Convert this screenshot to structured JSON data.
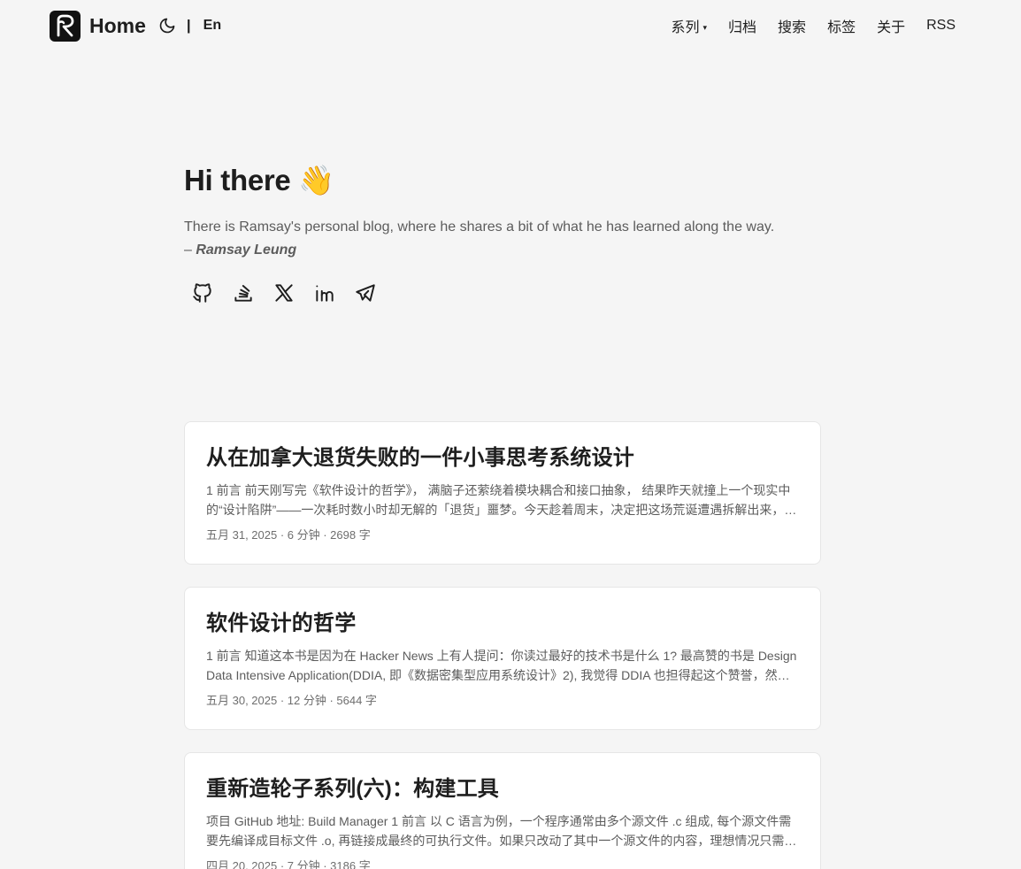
{
  "header": {
    "home_label": "Home",
    "separator": "|",
    "lang_label": "En",
    "logo_icon": "r-logo-icon",
    "theme_icon": "moon-icon",
    "nav": [
      {
        "label": "系列",
        "caret": "▾"
      },
      {
        "label": "归档"
      },
      {
        "label": "搜索"
      },
      {
        "label": "标签"
      },
      {
        "label": "关于"
      },
      {
        "label": "RSS"
      }
    ]
  },
  "hero": {
    "title": "Hi there 👋",
    "description": "There is Ramsay's personal blog, where he shares a bit of what he has learned along the way.",
    "dash": "– ",
    "author": "Ramsay Leung",
    "socials": [
      "github-icon",
      "stackoverflow-icon",
      "x-icon",
      "linkedin-icon",
      "telegram-icon"
    ]
  },
  "posts": [
    {
      "title": "从在加拿大退货失败的一件小事思考系统设计",
      "summary": "1 前言 前天刚写完《软件设计的哲学》， 满脑子还萦绕着模块耦合和接口抽象， 结果昨天就撞上一个现实中的“设计陷阱”——一次耗时数小时却无解的「退货」噩梦。今天趁着周末，决定把这场荒诞遭遇拆解出来，…",
      "meta": "五月 31, 2025 · 6 分钟 · 2698 字"
    },
    {
      "title": "软件设计的哲学",
      "summary": "1 前言 知道这本书是因为在 Hacker News 上有人提问：你读过最好的技术书是什么 1? 最高赞的书是 Design Data Intensive Application(DDIA, 即《数据密集型应用系统设计》2), 我觉得 DDIA 也担得起这个赞誉，然…",
      "meta": "五月 30, 2025 · 12 分钟 · 5644 字"
    },
    {
      "title": "重新造轮子系列(六)：构建工具",
      "summary": "项目 GitHub 地址: Build Manager 1 前言 以 C 语言为例，一个程序通常由多个源文件 .c 组成, 每个源文件需要先编译成目标文件 .o, 再链接成最终的可执行文件。如果只改动了其中一个源文件的内容，理想情况只需…",
      "meta": "四月 20, 2025 · 7 分钟 · 3186 字"
    }
  ]
}
